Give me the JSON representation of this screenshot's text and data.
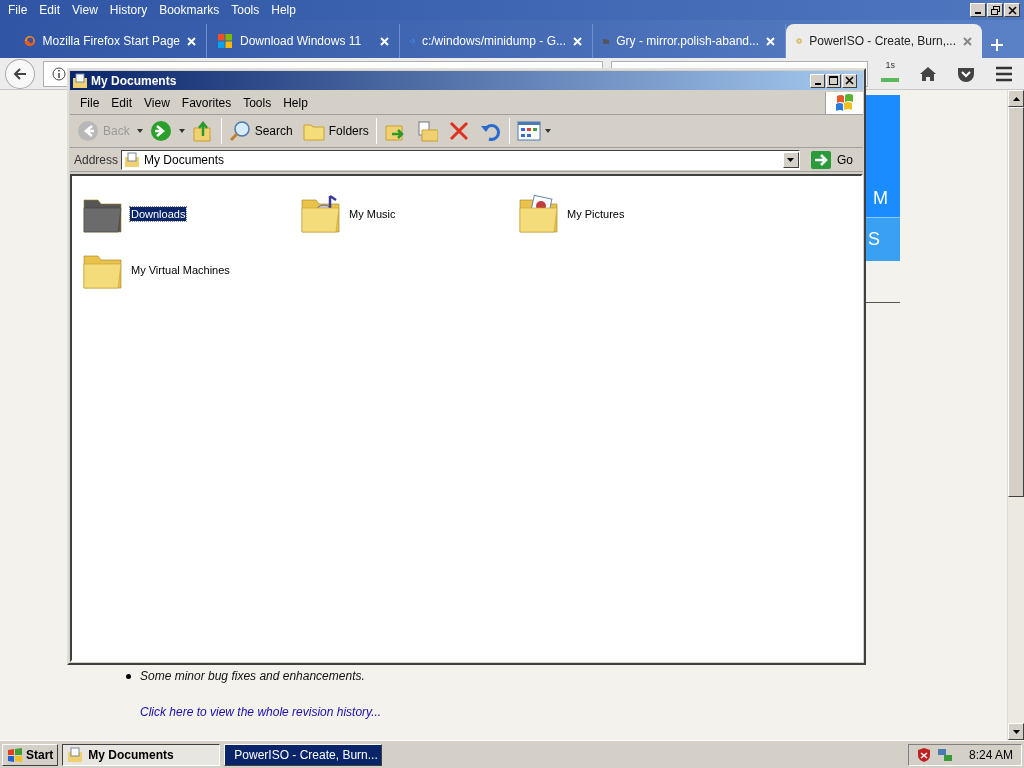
{
  "browser": {
    "menu": [
      "File",
      "Edit",
      "View",
      "History",
      "Bookmarks",
      "Tools",
      "Help"
    ],
    "tabs": [
      {
        "label": "Mozilla Firefox Start Page",
        "kind": "firefox",
        "selected": false
      },
      {
        "label": "Download Windows 11",
        "kind": "windows",
        "selected": false
      },
      {
        "label": "c:/windows/minidump - G...",
        "kind": "google",
        "selected": false
      },
      {
        "label": "Gry - mirror.polish-aband...",
        "kind": "folder",
        "selected": false
      },
      {
        "label": "PowerISO - Create, Burn,...",
        "kind": "disc",
        "selected": true
      }
    ],
    "download_badge": "1s",
    "page": {
      "banner_fragments": [
        "M",
        "S"
      ],
      "bullets": [
        "Some minor bug fixes and enhancements."
      ],
      "link": "Click here to view the whole revision history..."
    }
  },
  "explorer": {
    "title": "My Documents",
    "menu": [
      "File",
      "Edit",
      "View",
      "Favorites",
      "Tools",
      "Help"
    ],
    "nav": [
      {
        "kind": "back",
        "label": "Back",
        "disabled": true
      },
      {
        "kind": "forward",
        "disabled": false
      }
    ],
    "tools": [
      {
        "kind": "search",
        "label": "Search"
      },
      {
        "kind": "folders",
        "label": "Folders"
      }
    ],
    "address": {
      "label": "Address",
      "value": "My Documents",
      "go": "Go"
    },
    "items": [
      {
        "label": "Downloads",
        "kind": "plain",
        "selected": true
      },
      {
        "label": "My Music",
        "kind": "music",
        "selected": false
      },
      {
        "label": "My Pictures",
        "kind": "pictures",
        "selected": false
      },
      {
        "label": "My Virtual Machines",
        "kind": "plain",
        "selected": false
      }
    ]
  },
  "taskbar": {
    "start": "Start",
    "buttons": [
      {
        "label": "My Documents",
        "kind": "docs",
        "selected": true
      },
      {
        "label": "PowerISO - Create, Burn...",
        "kind": "firefox",
        "selected": false
      }
    ],
    "clock": "8:24 AM"
  }
}
